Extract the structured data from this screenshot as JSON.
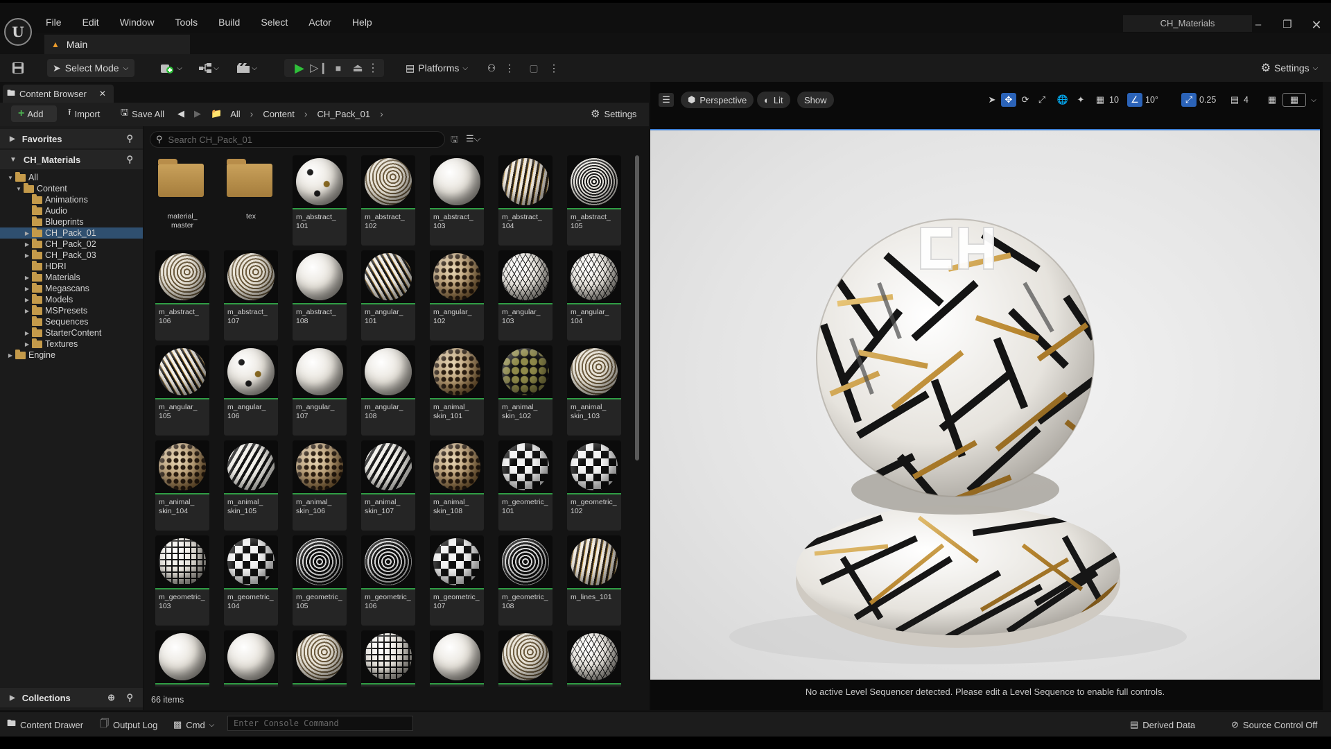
{
  "menu": [
    "File",
    "Edit",
    "Window",
    "Tools",
    "Build",
    "Select",
    "Actor",
    "Help"
  ],
  "project_name": "CH_Materials",
  "map_tab": "Main",
  "toolbar": {
    "select_mode": "Select Mode",
    "platforms": "Platforms",
    "settings": "Settings"
  },
  "content_browser": {
    "tab": "Content Browser",
    "add": "Add",
    "import": "Import",
    "save_all": "Save All",
    "breadcrumb": [
      "All",
      "Content",
      "CH_Pack_01"
    ],
    "settings": "Settings",
    "search_placeholder": "Search CH_Pack_01",
    "item_count": "66 items"
  },
  "tree": {
    "favorites": "Favorites",
    "root": "CH_Materials",
    "collections": "Collections",
    "items": [
      {
        "label": "All",
        "expanded": true,
        "level": 0
      },
      {
        "label": "Content",
        "expanded": true,
        "level": 1
      },
      {
        "label": "Animations",
        "level": 2
      },
      {
        "label": "Audio",
        "level": 2
      },
      {
        "label": "Blueprints",
        "level": 2
      },
      {
        "label": "CH_Pack_01",
        "level": 2,
        "arrow": true,
        "selected": true
      },
      {
        "label": "CH_Pack_02",
        "level": 2,
        "arrow": true
      },
      {
        "label": "CH_Pack_03",
        "level": 2,
        "arrow": true
      },
      {
        "label": "HDRI",
        "level": 2
      },
      {
        "label": "Materials",
        "level": 2,
        "arrow": true
      },
      {
        "label": "Megascans",
        "level": 2,
        "arrow": true
      },
      {
        "label": "Models",
        "level": 2,
        "arrow": true
      },
      {
        "label": "MSPresets",
        "level": 2,
        "arrow": true
      },
      {
        "label": "Sequences",
        "level": 2
      },
      {
        "label": "StarterContent",
        "level": 2,
        "arrow": true
      },
      {
        "label": "Textures",
        "level": 2,
        "arrow": true
      },
      {
        "label": "Engine",
        "level": 0,
        "arrow": true
      }
    ]
  },
  "assets": [
    {
      "name": "material_\nmaster",
      "kind": "folder"
    },
    {
      "name": "tex",
      "kind": "folder"
    },
    {
      "name": "m_abstract_\n101",
      "style": "stars"
    },
    {
      "name": "m_abstract_\n102",
      "style": "swirl"
    },
    {
      "name": "m_abstract_\n103",
      "style": "plain"
    },
    {
      "name": "m_abstract_\n104",
      "style": "stripes"
    },
    {
      "name": "m_abstract_\n105",
      "style": "maze"
    },
    {
      "name": "m_abstract_\n106",
      "style": "swirl"
    },
    {
      "name": "m_abstract_\n107",
      "style": "swirl"
    },
    {
      "name": "m_abstract_\n108",
      "style": "plain"
    },
    {
      "name": "m_angular_\n101",
      "style": "zigzag"
    },
    {
      "name": "m_angular_\n102",
      "style": "leopard"
    },
    {
      "name": "m_angular_\n103",
      "style": "tri"
    },
    {
      "name": "m_angular_\n104",
      "style": "tri"
    },
    {
      "name": "m_angular_\n105",
      "style": "zigzag"
    },
    {
      "name": "m_angular_\n106",
      "style": "stars"
    },
    {
      "name": "m_angular_\n107",
      "style": "plain"
    },
    {
      "name": "m_angular_\n108",
      "style": "plain"
    },
    {
      "name": "m_animal_\nskin_101",
      "style": "leopard"
    },
    {
      "name": "m_animal_\nskin_102",
      "style": "giraffe"
    },
    {
      "name": "m_animal_\nskin_103",
      "style": "swirl"
    },
    {
      "name": "m_animal_\nskin_104",
      "style": "leopard"
    },
    {
      "name": "m_animal_\nskin_105",
      "style": "zebra"
    },
    {
      "name": "m_animal_\nskin_106",
      "style": "leopard"
    },
    {
      "name": "m_animal_\nskin_107",
      "style": "zebra"
    },
    {
      "name": "m_animal_\nskin_108",
      "style": "leopard"
    },
    {
      "name": "m_geometric_\n101",
      "style": "check"
    },
    {
      "name": "m_geometric_\n102",
      "style": "check"
    },
    {
      "name": "m_geometric_\n103",
      "style": "grid"
    },
    {
      "name": "m_geometric_\n104",
      "style": "check"
    },
    {
      "name": "m_geometric_\n105",
      "style": "darkswirl"
    },
    {
      "name": "m_geometric_\n106",
      "style": "darkswirl"
    },
    {
      "name": "m_geometric_\n107",
      "style": "check"
    },
    {
      "name": "m_geometric_\n108",
      "style": "darkswirl"
    },
    {
      "name": "m_lines_101",
      "style": "stripes"
    },
    {
      "name": "",
      "style": "plain"
    },
    {
      "name": "",
      "style": "plain"
    },
    {
      "name": "",
      "style": "swirl"
    },
    {
      "name": "",
      "style": "grid"
    },
    {
      "name": "",
      "style": "plain"
    },
    {
      "name": "",
      "style": "swirl"
    },
    {
      "name": "",
      "style": "tri"
    }
  ],
  "viewport": {
    "perspective": "Perspective",
    "lit": "Lit",
    "show": "Show",
    "grid_snap": "10",
    "rot_snap": "10°",
    "scale_snap": "0.25",
    "cam_speed": "4",
    "sequencer_msg": "No active Level Sequencer detected. Please edit a Level Sequence to enable full controls."
  },
  "statusbar": {
    "content_drawer": "Content Drawer",
    "output_log": "Output Log",
    "cmd": "Cmd",
    "console_placeholder": "Enter Console Command",
    "derived_data": "Derived Data",
    "source_control": "Source Control Off"
  },
  "colors": {
    "accent_blue": "#3d7fd4",
    "play_green": "#2fbf3a",
    "folder": "#c49a4a",
    "selected_row": "#2f4f6f"
  }
}
